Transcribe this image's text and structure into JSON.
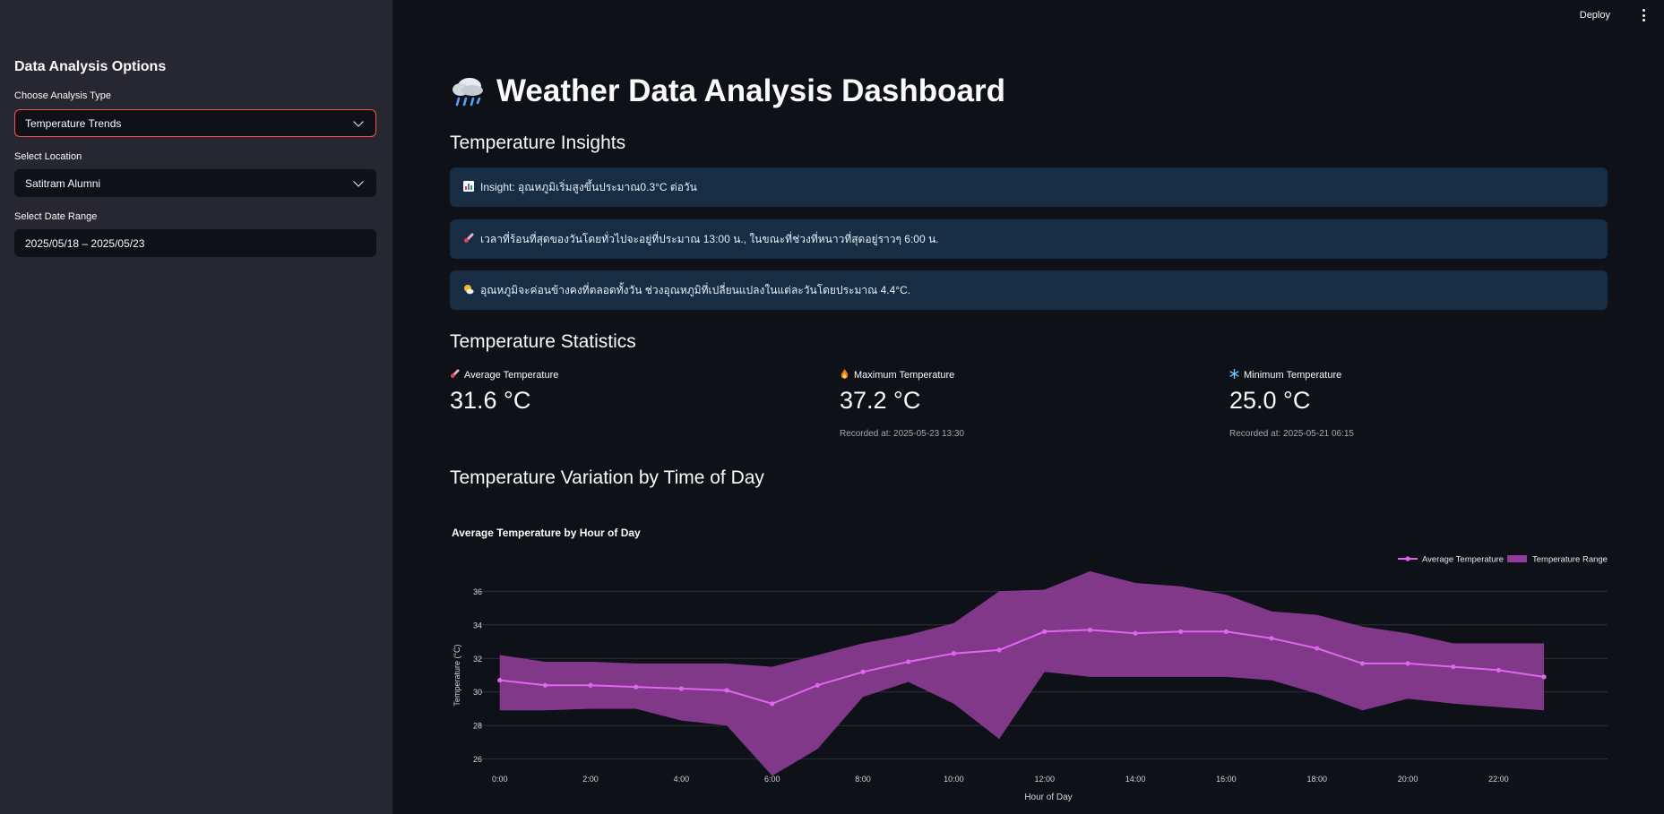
{
  "header": {
    "deploy_label": "Deploy"
  },
  "sidebar": {
    "title": "Data Analysis Options",
    "analysis_label": "Choose Analysis Type",
    "analysis_value": "Temperature Trends",
    "location_label": "Select Location",
    "location_value": "Satitram Alumni",
    "date_label": "Select Date Range",
    "date_value": "2025/05/18 – 2025/05/23"
  },
  "main": {
    "title": "Weather Data Analysis Dashboard",
    "title_icon": "cloud-rain-icon",
    "insights_heading": "Temperature Insights",
    "insights": [
      {
        "icon": "bar-chart-icon",
        "text": "Insight: อุณหภูมิเริ่มสูงขึ้นประมาณ0.3°C ต่อวัน"
      },
      {
        "icon": "thermometer-icon",
        "text": "เวลาที่ร้อนที่สุดของวันโดยทั่วไปจะอยู่ที่ประมาณ 13:00 น., ในขณะที่ช่วงที่หนาวที่สุดอยู่ราวๆ 6:00 น."
      },
      {
        "icon": "sun-cloud-icon",
        "text": "อุณหภูมิจะค่อนข้างคงที่ตลอดทั้งวัน ช่วงอุณหภูมิที่เปลี่ยนแปลงในแต่ละวันโดยประมาณ 4.4°C."
      }
    ],
    "stats_heading": "Temperature Statistics",
    "stats": [
      {
        "icon": "thermometer-icon",
        "label": "Average Temperature",
        "value": "31.6 °C",
        "note": ""
      },
      {
        "icon": "fire-icon",
        "label": "Maximum Temperature",
        "value": "37.2 °C",
        "note": "Recorded at: 2025-05-23 13:30"
      },
      {
        "icon": "snowflake-icon",
        "label": "Minimum Temperature",
        "value": "25.0 °C",
        "note": "Recorded at: 2025-05-21 06:15"
      }
    ],
    "variation_heading": "Temperature Variation by Time of Day"
  },
  "colors": {
    "accent": "#ff4b4b",
    "line": "#e066f0",
    "range_fill": "#8e3d96",
    "insight_bg": "#172d43"
  },
  "chart_data": {
    "type": "area",
    "title": "Average Temperature by Hour of Day",
    "xlabel": "Hour of Day",
    "ylabel": "Temperature (°C)",
    "x": [
      0,
      1,
      2,
      3,
      4,
      5,
      6,
      7,
      8,
      9,
      10,
      11,
      12,
      13,
      14,
      15,
      16,
      17,
      18,
      19,
      20,
      21,
      22,
      23
    ],
    "xticks": [
      0,
      2,
      4,
      6,
      8,
      10,
      12,
      14,
      16,
      18,
      20,
      22
    ],
    "xtick_labels": [
      "0:00",
      "2:00",
      "4:00",
      "6:00",
      "8:00",
      "10:00",
      "12:00",
      "14:00",
      "16:00",
      "18:00",
      "20:00",
      "22:00"
    ],
    "yticks": [
      26,
      28,
      30,
      32,
      34,
      36
    ],
    "ylim": [
      24.7,
      37.3
    ],
    "xlim": [
      -1.1,
      24.4
    ],
    "series": [
      {
        "name": "Average Temperature",
        "type": "line",
        "values": [
          30.7,
          30.4,
          30.4,
          30.3,
          30.2,
          30.1,
          29.3,
          30.4,
          31.2,
          31.8,
          32.3,
          32.5,
          33.6,
          33.7,
          33.5,
          33.6,
          33.6,
          33.2,
          32.6,
          31.7,
          31.7,
          31.5,
          31.3,
          30.9
        ]
      },
      {
        "name": "Temperature Range",
        "type": "band",
        "upper": [
          32.2,
          31.8,
          31.8,
          31.7,
          31.7,
          31.7,
          31.5,
          32.2,
          32.9,
          33.4,
          34.1,
          36.0,
          36.1,
          37.2,
          36.5,
          36.3,
          35.8,
          34.8,
          34.6,
          33.9,
          33.5,
          32.9,
          32.9,
          32.9
        ],
        "lower": [
          28.9,
          28.9,
          29.0,
          29.0,
          28.3,
          28.0,
          25.0,
          26.6,
          29.7,
          30.6,
          29.3,
          27.2,
          31.2,
          30.9,
          30.9,
          30.9,
          30.9,
          30.7,
          29.9,
          28.9,
          29.6,
          29.3,
          29.1,
          28.9
        ]
      }
    ],
    "legend": "top-right",
    "grid": true
  }
}
